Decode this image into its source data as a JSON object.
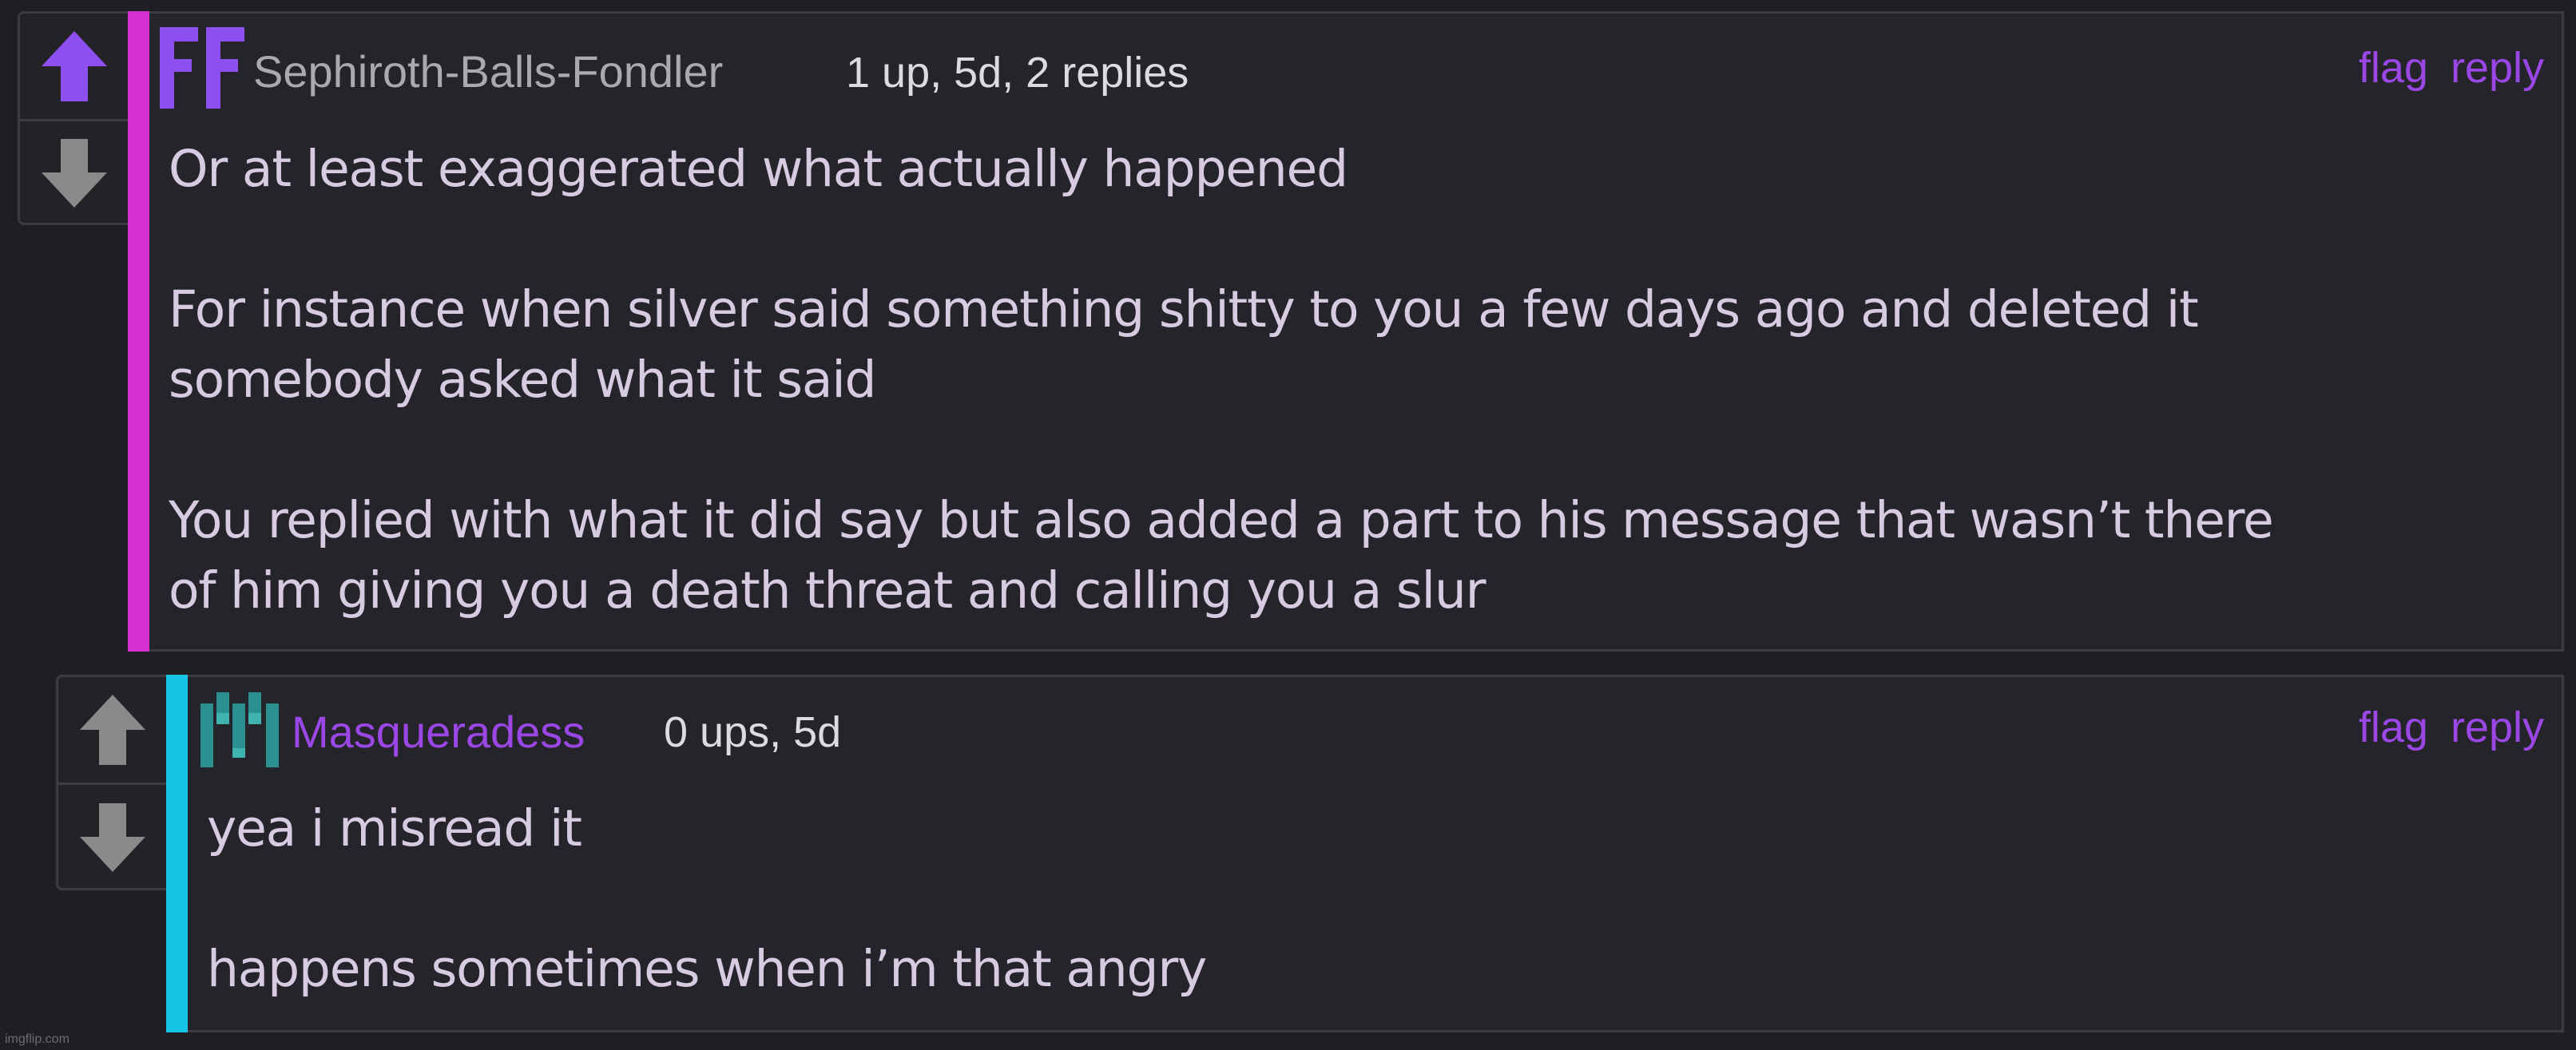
{
  "comments": [
    {
      "username": "Sephiroth-Balls-Fondler",
      "avatar_text": "FF",
      "meta": "1 up, 5d, 2 replies",
      "actions": {
        "flag": "flag",
        "reply": "reply"
      },
      "lines": [
        "Or at least exaggerated what actually happened",
        "",
        "For instance when silver said something shitty to you a few days ago and deleted it",
        "somebody asked what it said",
        "",
        "You replied with what it did say but also added a part to his message that wasn’t there",
        "of him giving you a death threat and calling you a slur"
      ],
      "accent_color": "#d42fd0",
      "upvote_color": "#8e4ff0"
    },
    {
      "username": "Masqueradess",
      "avatar_text": "M",
      "meta": "0 ups, 5d",
      "actions": {
        "flag": "flag",
        "reply": "reply"
      },
      "lines": [
        "yea i misread it",
        "",
        "happens sometimes when i’m that angry"
      ],
      "accent_color": "#16c5e3",
      "upvote_color": "#8a8a8a"
    }
  ],
  "watermark": "imgflip.com",
  "colors": {
    "background": "#1f1e23",
    "panel": "#25242a",
    "border": "#3c3b42",
    "link": "#9b47e6",
    "text": "#d7cbe2"
  },
  "icons": [
    "upvote-arrow-icon",
    "downvote-arrow-icon"
  ]
}
